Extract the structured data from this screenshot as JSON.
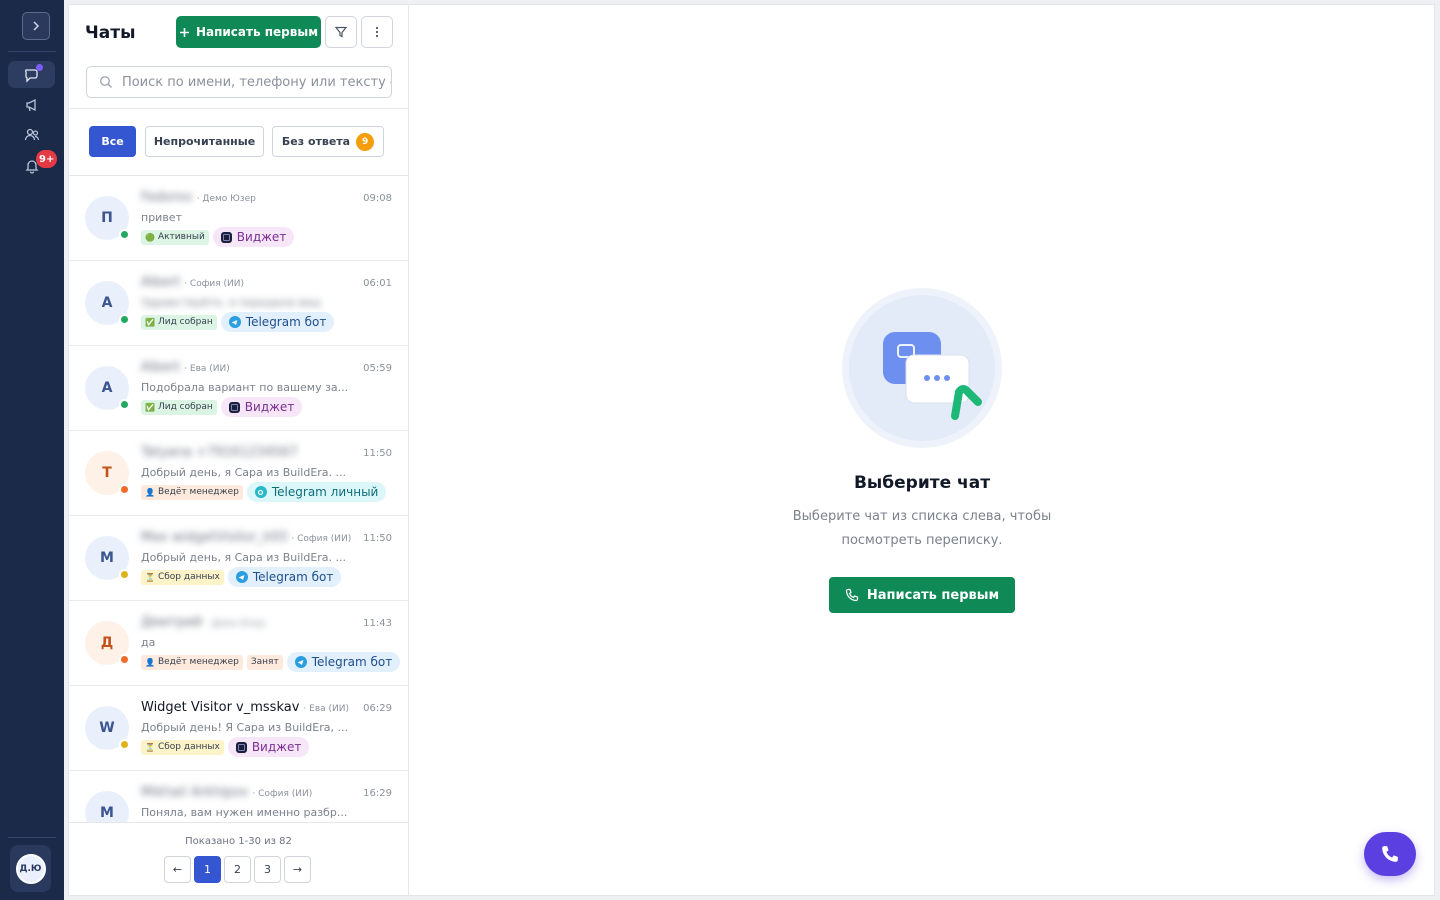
{
  "rail": {
    "notifications_badge": "9+",
    "user_initials": "Д.Ю"
  },
  "chats": {
    "title": "Чаты",
    "write_first_label": "Написать первым",
    "search_placeholder": "Поиск по имени, телефону или тексту с",
    "filters": {
      "all": "Все",
      "unread": "Непрочитанные",
      "no_reply": "Без ответа",
      "no_reply_count": "9"
    },
    "items": [
      {
        "initial": "П",
        "name": "Fedorov",
        "agent": "· Демо Юзер",
        "time": "09:08",
        "message": "привет",
        "message_blurred": false,
        "status": "Активный",
        "status_icon": "🟢",
        "channel": "Виджет",
        "extra_tag": null
      },
      {
        "initial": "А",
        "name": "Albert",
        "agent": "· София (ИИ)",
        "time": "06:01",
        "message": "Здравствуйте, я передала ваш",
        "message_blurred": true,
        "status": "Лид собран",
        "status_icon": "✅",
        "channel": "Telegram бот",
        "extra_tag": null
      },
      {
        "initial": "А",
        "name": "Albert",
        "agent": "· Ева (ИИ)",
        "time": "05:59",
        "message": "Подобрала вариант по вашему за...",
        "message_blurred": false,
        "status": "Лид собран",
        "status_icon": "✅",
        "channel": "Виджет",
        "extra_tag": null
      },
      {
        "initial": "Т",
        "name": "Tatyana +79161234567",
        "agent": "",
        "time": "11:50",
        "message": "Добрый день, я Сара из BuildEra. ...",
        "message_blurred": false,
        "status": "Ведёт менеджер",
        "status_icon": "👤",
        "channel": "Telegram личный",
        "extra_tag": null
      },
      {
        "initial": "М",
        "name": "Max widgetVisitor_k93",
        "agent": "· София (ИИ)",
        "time": "11:50",
        "message": "Добрый день, я Сара из BuildEra. ...",
        "message_blurred": false,
        "status": "Сбор данных",
        "status_icon": "⏳",
        "channel": "Telegram бот",
        "extra_tag": null
      },
      {
        "initial": "Д",
        "name": "Дмитрий",
        "agent": "· Демо Юзер",
        "time": "11:43",
        "message": "да",
        "message_blurred": false,
        "status": "Ведёт менеджер",
        "status_icon": "👤",
        "channel": "Telegram бот",
        "extra_tag": "Занят"
      },
      {
        "initial": "W",
        "name": "Widget Visitor v_msskav",
        "agent": "· Ева (ИИ)",
        "time": "06:29",
        "message": "Добрый день! Я Сара из BuildEra, ...",
        "message_blurred": false,
        "status": "Сбор данных",
        "status_icon": "⏳",
        "channel": "Виджет",
        "extra_tag": null
      },
      {
        "initial": "М",
        "name": "Mikhail Arkhipov",
        "agent": "· София (ИИ)",
        "time": "16:29",
        "message": "Поняла, вам нужен именно разбр...",
        "message_blurred": false,
        "status": "",
        "status_icon": "",
        "channel": "",
        "extra_tag": null
      }
    ],
    "pagination": {
      "info": "Показано 1-30 из 82",
      "prev": "←",
      "next": "→",
      "pages": [
        "1",
        "2",
        "3"
      ],
      "current": "1"
    }
  },
  "empty_state": {
    "title": "Выберите чат",
    "subtitle": "Выберите чат из списка слева, чтобы посмотреть переписку.",
    "button": "Написать первым"
  },
  "colors": {
    "rail_bg": "#1c2a4a",
    "primary_green": "#0f8a56",
    "accent_blue": "#3456d1",
    "fab_purple": "#5b3fe0"
  }
}
